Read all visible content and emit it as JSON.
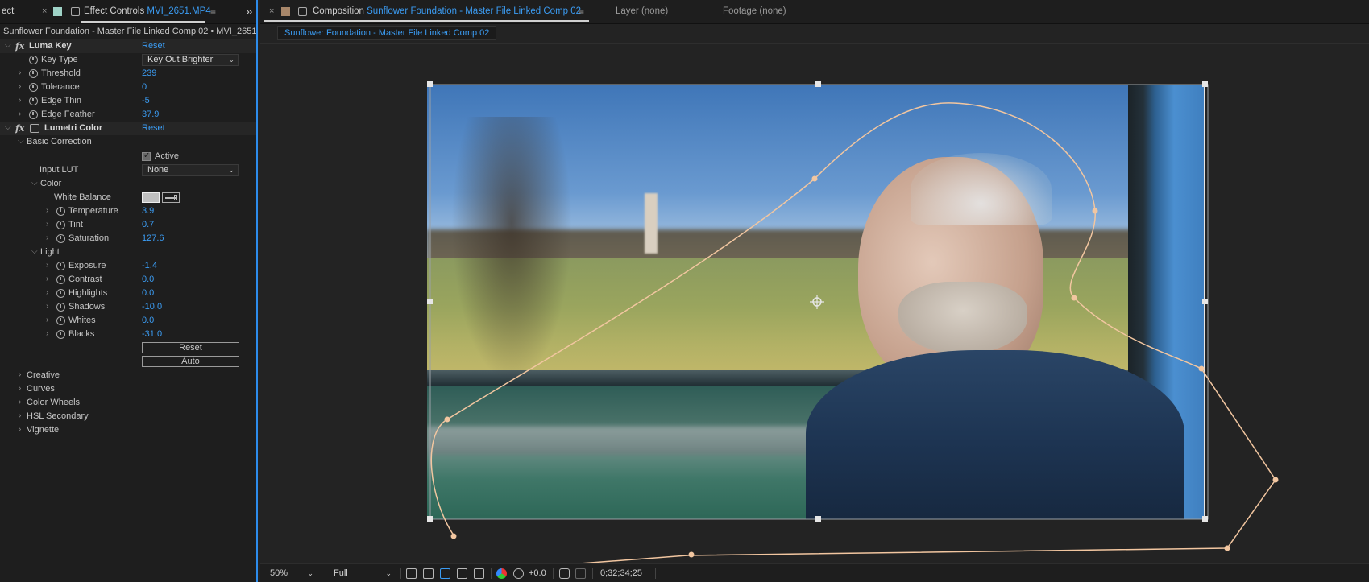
{
  "left_panel": {
    "tab_prev": "ect",
    "tab_title": "Effect Controls",
    "tab_file": "MVI_2651.MP4",
    "expand_glyph": "»",
    "subtitle": "Sunflower Foundation -  Master File Linked Comp 02 • MVI_2651",
    "luma_key": {
      "name": "Luma Key",
      "reset": "Reset",
      "key_type_label": "Key Type",
      "key_type_value": "Key Out Brighter",
      "threshold_label": "Threshold",
      "threshold_value": "239",
      "tolerance_label": "Tolerance",
      "tolerance_value": "0",
      "edge_thin_label": "Edge Thin",
      "edge_thin_value": "-5",
      "edge_feather_label": "Edge Feather",
      "edge_feather_value": "37.9"
    },
    "lumetri": {
      "name": "Lumetri Color",
      "reset": "Reset",
      "basic_correction": "Basic Correction",
      "active_label": "Active",
      "input_lut_label": "Input LUT",
      "input_lut_value": "None",
      "color_group": "Color",
      "white_balance_label": "White Balance",
      "temperature_label": "Temperature",
      "temperature_value": "3.9",
      "tint_label": "Tint",
      "tint_value": "0.7",
      "saturation_label": "Saturation",
      "saturation_value": "127.6",
      "light_group": "Light",
      "exposure_label": "Exposure",
      "exposure_value": "-1.4",
      "contrast_label": "Contrast",
      "contrast_value": "0.0",
      "highlights_label": "Highlights",
      "highlights_value": "0.0",
      "shadows_label": "Shadows",
      "shadows_value": "-10.0",
      "whites_label": "Whites",
      "whites_value": "0.0",
      "blacks_label": "Blacks",
      "blacks_value": "-31.0",
      "reset_button": "Reset",
      "auto_button": "Auto",
      "sections": [
        "Creative",
        "Curves",
        "Color Wheels",
        "HSL Secondary",
        "Vignette"
      ]
    }
  },
  "composition": {
    "tab_label": "Composition",
    "tab_name": "Sunflower Foundation -  Master File Linked Comp 02",
    "layer_tab": "Layer (none)",
    "footage_tab": "Footage (none)",
    "sub_tab": "Sunflower Foundation -  Master File Linked Comp 02"
  },
  "viewer_bar": {
    "zoom": "50%",
    "resolution": "Full",
    "exposure": "+0.0",
    "timecode": "0;32;34;25"
  },
  "colors": {
    "accent": "#3b9cf3",
    "mask": "#f2c6a0",
    "panel_bg": "#1e1e1e"
  }
}
